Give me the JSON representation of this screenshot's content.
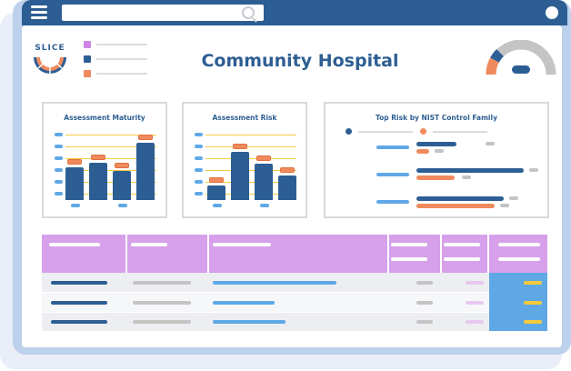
{
  "app": {
    "title": "Community Hospital"
  },
  "logo": {
    "text": "SLICE"
  },
  "search": {
    "placeholder": ""
  },
  "legend": [
    {
      "color": "#cf86e6"
    },
    {
      "color": "#2d5e93"
    },
    {
      "color": "#f08a5d"
    }
  ],
  "panels": {
    "maturity": {
      "title": "Assessment Maturity",
      "levels": [
        0.5,
        0.57,
        0.44,
        0.88
      ]
    },
    "risk": {
      "title": "Assessment Risk",
      "levels": [
        0.22,
        0.74,
        0.56,
        0.38
      ]
    },
    "nist": {
      "title": "Top Risk by NIST Control Family"
    }
  },
  "gauge": {
    "level": 0.2
  },
  "colors": {
    "navy": "#2d5e93",
    "orange": "#f08a5d",
    "purple": "#d6a0ea",
    "lightblue": "#5fa8e6",
    "gray": "#c4c4c4",
    "pink": "#e7c9f0",
    "yellow": "#f5cb3c"
  }
}
